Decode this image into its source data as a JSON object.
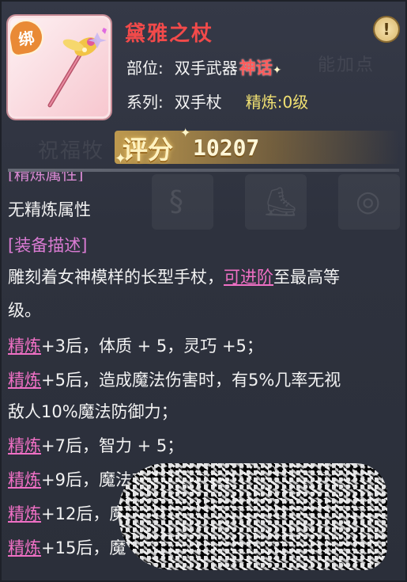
{
  "item": {
    "bound_badge": "绑",
    "name": "黛雅之杖",
    "info_icon": "info-icon",
    "slot_label": "部位:",
    "slot_value": "双手武器",
    "rarity": "神话",
    "type_label": "系列:",
    "type_value": "双手杖",
    "refine_label": "精炼:",
    "refine_value": "0级"
  },
  "score": {
    "label": "评分",
    "value": "10207"
  },
  "background": {
    "ghost_tab_1": "祝福牧",
    "ghost_tab_2": "能加点"
  },
  "refine_attributes": {
    "title_peek": "[精炼属性]",
    "text": "无精炼属性"
  },
  "description": {
    "title": "[装备描述]",
    "line1_a": "雕刻着女神模样的长型手杖，",
    "line1_link": "可进阶",
    "line1_b": "至最高等",
    "line2": "级。"
  },
  "refine_bonuses": [
    {
      "link": "精炼",
      "text": "+3后，体质 + 5，灵巧 +5；"
    },
    {
      "link": "精炼",
      "text": "+5后，造成魔法伤害时，有5%几率无视"
    },
    {
      "link": "",
      "text": "敌人10%魔法防御力；"
    },
    {
      "link": "精炼",
      "text": "+7后，智力 + 5；"
    },
    {
      "link": "精炼",
      "text": "+9后，魔法攻击力 + 5%；"
    },
    {
      "link": "精炼",
      "text": "+12后，魔"
    },
    {
      "link": "精炼",
      "text": "+15后，魔"
    }
  ],
  "colors": {
    "item_name": "#f24a4a",
    "section_title": "#da7bd3",
    "link": "#f070c5",
    "refine_value": "#f0e072"
  }
}
